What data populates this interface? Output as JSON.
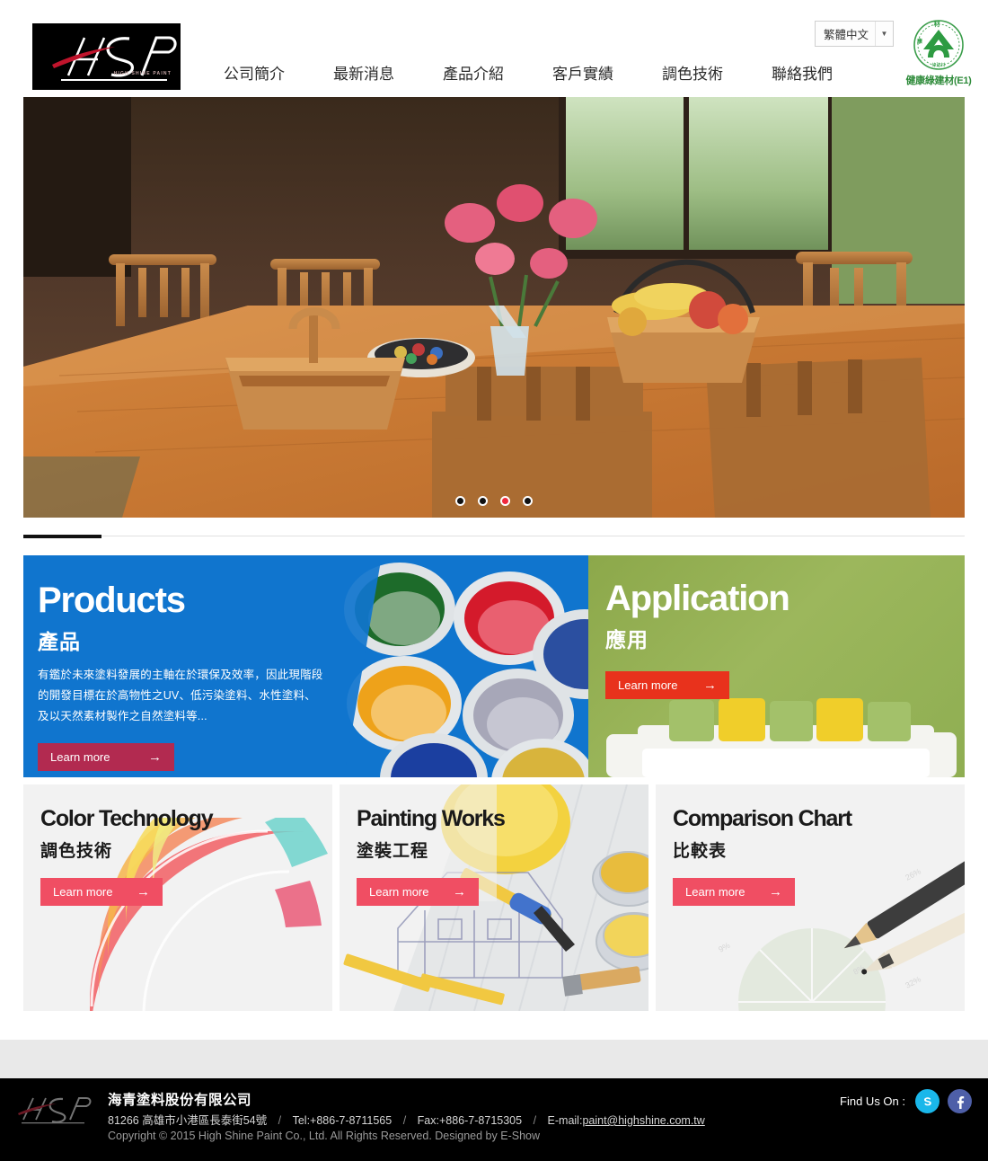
{
  "header": {
    "logo_alt": "HSP",
    "logo_subtitle": "HIGH SHINE PAINT",
    "language": {
      "selected": "繁體中文",
      "caret": "▼"
    },
    "eco_badge": {
      "caption": "健康綠建材(E1)",
      "color": "#2e8b3a"
    },
    "nav": [
      {
        "label": "公司簡介"
      },
      {
        "label": "最新消息"
      },
      {
        "label": "產品介紹"
      },
      {
        "label": "客戶實績"
      },
      {
        "label": "調色技術"
      },
      {
        "label": "聯絡我們"
      }
    ]
  },
  "hero": {
    "slides_count": 4,
    "active_slide": 3,
    "alt": "wooden dining table with chairs, flowers and fruit basket"
  },
  "cards": {
    "products": {
      "title_en": "Products",
      "title_zh": "產品",
      "description": "有鑑於未來塗料發展的主軸在於環保及效率，因此現階段的開發目標在於高物性之UV、低污染塗料、水性塗料、及以天然素材製作之自然塗料等...",
      "button": "Learn more",
      "arrow": "→",
      "bg_color": "#1075ce",
      "button_color": "#b22a50"
    },
    "application": {
      "title_en": "Application",
      "title_zh": "應用",
      "button": "Learn more",
      "arrow": "→",
      "bg_color": "#8fae52",
      "button_color": "#e8321c"
    },
    "color_technology": {
      "title_en": "Color Technology",
      "title_zh": "調色技術",
      "button": "Learn more",
      "arrow": "→",
      "bg_color": "#f2f2f2",
      "button_color": "#f04e63"
    },
    "painting_works": {
      "title_en": "Painting Works",
      "title_zh": "塗裝工程",
      "button": "Learn more",
      "arrow": "→",
      "bg_color": "#f2f2f2",
      "button_color": "#f04e63"
    },
    "comparison_chart": {
      "title_en": "Comparison Chart",
      "title_zh": "比較表",
      "button": "Learn more",
      "arrow": "→",
      "bg_color": "#f2f2f2",
      "button_color": "#f04e63"
    }
  },
  "footer": {
    "company": "海青塗料股份有限公司",
    "address": "81266 高雄市小港區長泰街54號",
    "tel_label": "Tel:+886-7-8711565",
    "fax_label": "Fax:+886-7-8715305",
    "email_label": "E-mail:",
    "email": "paint@highshine.com.tw",
    "separator": "/",
    "copyright": "Copyright © 2015 High Shine Paint Co., Ltd. All Rights Reserved. Designed by E-Show",
    "find_us_label": "Find Us On :",
    "social": [
      {
        "name": "skype",
        "color": "#1ab7ea"
      },
      {
        "name": "facebook",
        "color": "#4e5fa8"
      }
    ]
  }
}
